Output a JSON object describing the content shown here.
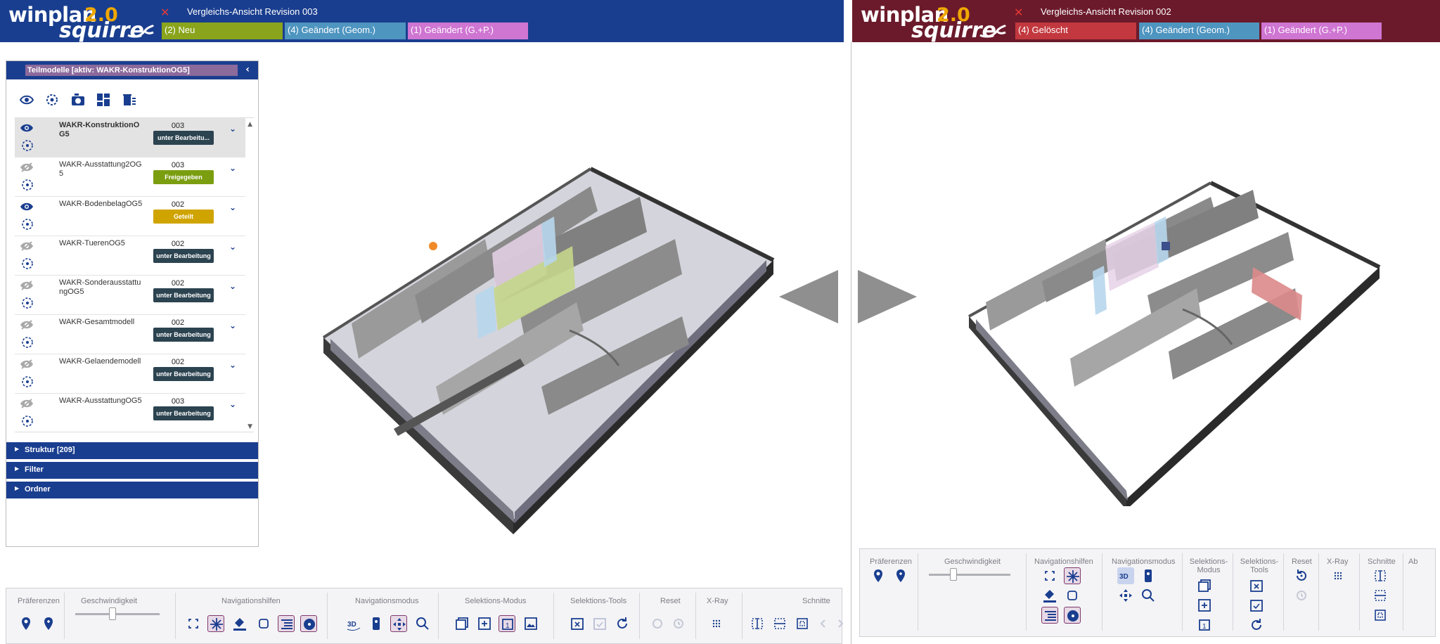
{
  "left_pane": {
    "logo_word": "winplan",
    "logo_version": "2.0",
    "logo_product": "squirre",
    "title": "Vergleichs-Ansicht Revision 003",
    "badges": [
      {
        "label": "(2) Neu",
        "color": "#8aa41c"
      },
      {
        "label": "(4) Geändert (Geom.)",
        "color": "#4e95c0"
      },
      {
        "label": "(1) Geändert (G.+P.)",
        "color": "#cf75d2"
      }
    ]
  },
  "right_pane": {
    "logo_word": "winplan",
    "logo_version": "2.0",
    "logo_product": "squirre",
    "title": "Vergleichs-Ansicht Revision 002",
    "badges": [
      {
        "label": "(4) Gelöscht",
        "color": "#c2383e"
      },
      {
        "label": "(4) Geändert (Geom.)",
        "color": "#4e95c0"
      },
      {
        "label": "(1) Geändert (G.+P.)",
        "color": "#cf75d2"
      }
    ]
  },
  "side_panel": {
    "title": "Teilmodelle [aktiv: WAKR-KonstruktionOG5]",
    "models": [
      {
        "name": "WAKR-KonstruktionOG5",
        "revision": "003",
        "status": "unter Bearbeitu...",
        "status_color": "#2c4350",
        "visible": true,
        "active": true
      },
      {
        "name": "WAKR-Ausstattung2OG5",
        "revision": "003",
        "status": "Freigegeben",
        "status_color": "#7b9e11",
        "visible": false,
        "active": false
      },
      {
        "name": "WAKR-BodenbelagOG5",
        "revision": "002",
        "status": "Geteilt",
        "status_color": "#d0a400",
        "visible": true,
        "active": false
      },
      {
        "name": "WAKR-TuerenOG5",
        "revision": "002",
        "status": "unter Bearbeitung",
        "status_color": "#2c4350",
        "visible": false,
        "active": false
      },
      {
        "name": "WAKR-SonderausstattungOG5",
        "revision": "002",
        "status": "unter Bearbeitung",
        "status_color": "#2c4350",
        "visible": false,
        "active": false
      },
      {
        "name": "WAKR-Gesamtmodell",
        "revision": "002",
        "status": "unter Bearbeitung",
        "status_color": "#2c4350",
        "visible": false,
        "active": false
      },
      {
        "name": "WAKR-Gelaendemodell",
        "revision": "002",
        "status": "unter Bearbeitung",
        "status_color": "#2c4350",
        "visible": false,
        "active": false
      },
      {
        "name": "WAKR-AusstattungOG5",
        "revision": "003",
        "status": "unter Bearbeitung",
        "status_color": "#2c4350",
        "visible": false,
        "active": false
      }
    ],
    "sections": [
      "Struktur [209]",
      "Filter",
      "Ordner"
    ]
  },
  "toolbar_left": {
    "groups": [
      "Präferenzen",
      "Geschwindigkeit",
      "Navigationshilfen",
      "Navigationsmodus",
      "Selektions-Modus",
      "Selektions-Tools",
      "Reset",
      "X-Ray",
      "Schnitte"
    ]
  },
  "toolbar_right": {
    "groups": [
      "Präferenzen",
      "Geschwindigkeit",
      "Navigationshilfen",
      "Navigationsmodus",
      "Selektions-Modus",
      "Selektions-Tools",
      "Reset",
      "X-Ray",
      "Schnitte",
      "Ab"
    ]
  },
  "icons": [
    "eye-icon",
    "eye-off-icon",
    "target-icon",
    "camera-icon",
    "layout-icon",
    "delete-list-icon",
    "pin-icon",
    "add-pin-icon",
    "fullscreen-icon",
    "compass-icon",
    "paint-icon",
    "frame-icon",
    "list-icon",
    "fan-icon",
    "3d-icon",
    "walk-icon",
    "move-icon",
    "zoom-icon",
    "select-box-icon",
    "select-plus-icon",
    "select-one-icon",
    "select-image-icon",
    "calendar-x-icon",
    "calendar-check-icon",
    "refresh-icon",
    "reset-icon",
    "history-icon",
    "xray-icon",
    "section-icon"
  ],
  "colors": {
    "left_header": "#1a3e8f",
    "right_header": "#6b1a2b",
    "accent_orange": "#f0a800"
  }
}
